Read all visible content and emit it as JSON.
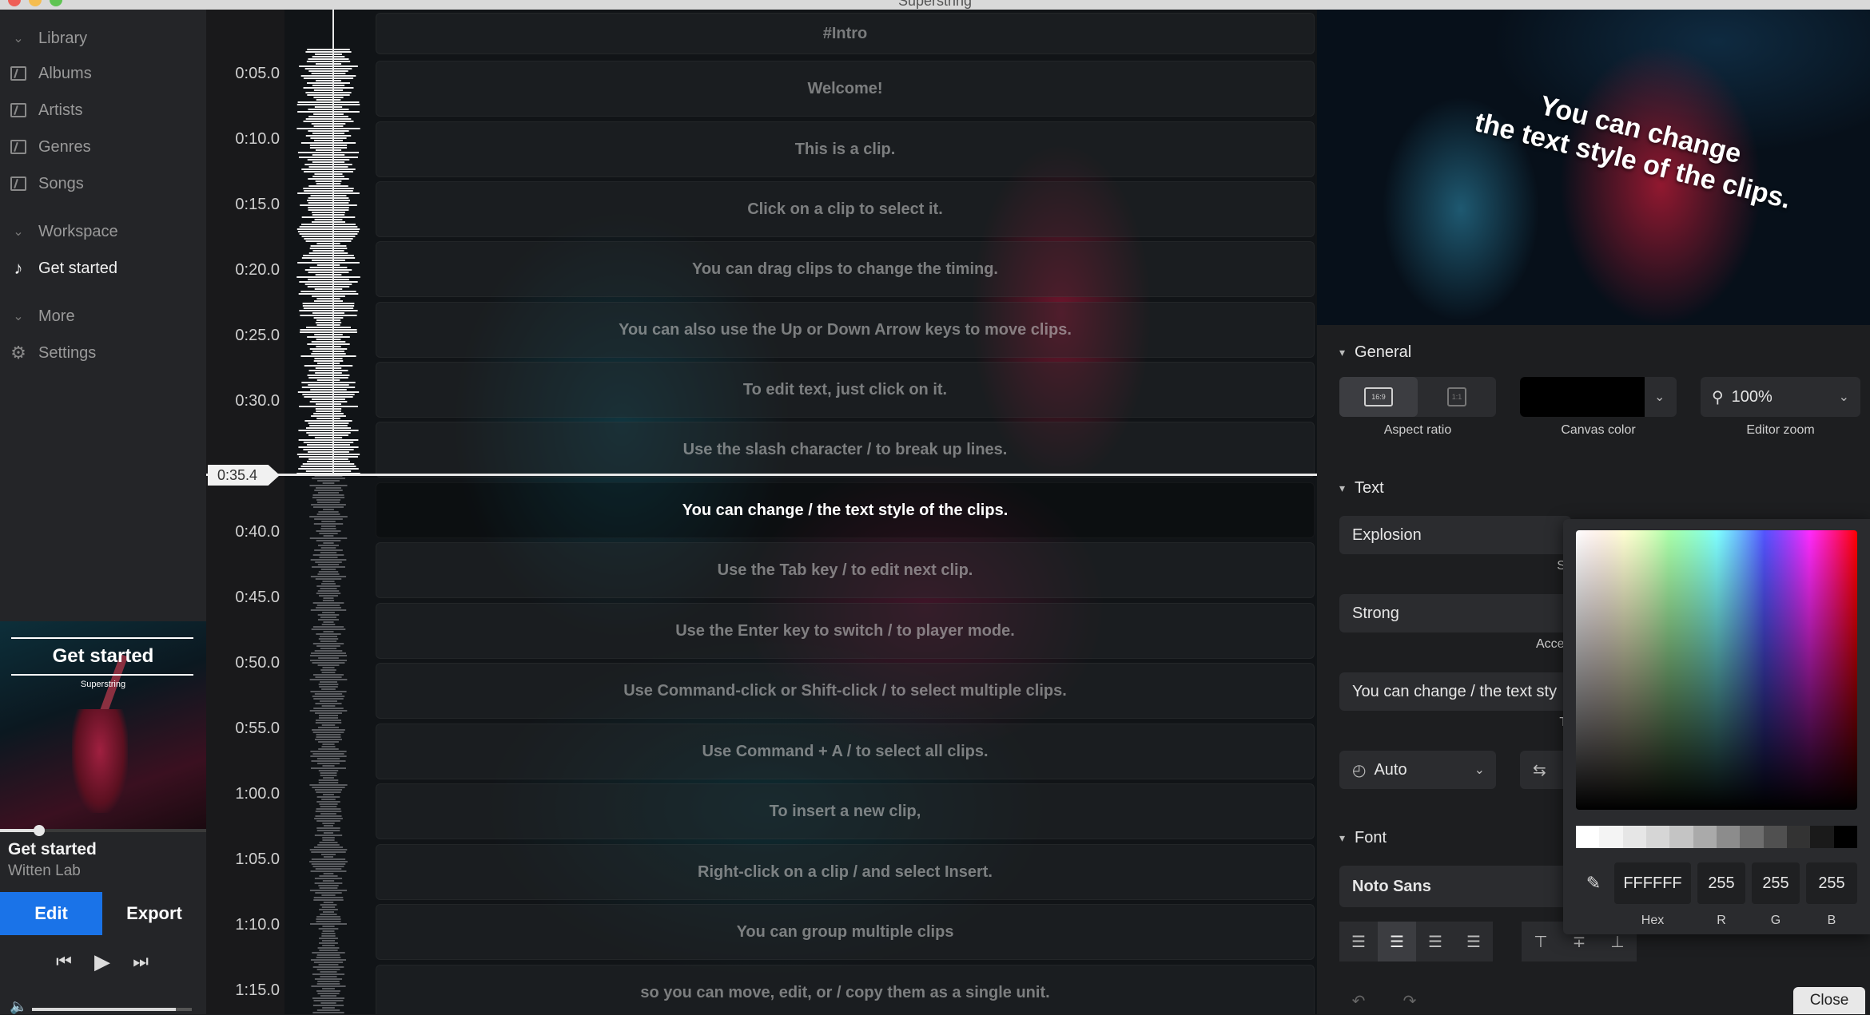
{
  "window": {
    "title": "Superstring"
  },
  "sidebar": {
    "sections": [
      {
        "label": "Library",
        "items": [
          {
            "label": "Albums"
          },
          {
            "label": "Artists"
          },
          {
            "label": "Genres"
          },
          {
            "label": "Songs"
          }
        ]
      },
      {
        "label": "Workspace",
        "items": [
          {
            "label": "Get started"
          }
        ]
      },
      {
        "label": "More",
        "items": [
          {
            "label": "Settings"
          }
        ]
      }
    ],
    "now_playing": {
      "art_title": "Get started",
      "art_subtitle": "Superstring",
      "title": "Get started",
      "artist": "Witten Lab",
      "progress": 0.19,
      "volume": 0.9
    },
    "modes": {
      "edit": "Edit",
      "export": "Export"
    }
  },
  "timeline": {
    "ticks": [
      "0:05.0",
      "0:10.0",
      "0:15.0",
      "0:20.0",
      "0:25.0",
      "0:30.0",
      "0:40.0",
      "0:45.0",
      "0:50.0",
      "0:55.0",
      "1:00.0",
      "1:05.0",
      "1:10.0",
      "1:15.0"
    ],
    "playhead": "0:35.4",
    "clips": [
      "#Intro",
      "Welcome!",
      "This is a clip.",
      "Click on a clip to select it.",
      "You can drag clips to change the timing.",
      "You can also use the Up or Down Arrow keys to move clips.",
      "To edit text, just click on it.",
      "Use the slash character / to break up lines.",
      "You can change / the text style of the clips.",
      "Use the Tab key / to edit next clip.",
      "Use the Enter key to switch / to player mode.",
      "Use Command-click or Shift-click / to select multiple clips.",
      "Use Command + A / to select all clips.",
      "To insert a new clip,",
      "Right-click on a clip / and select Insert.",
      "You can group multiple clips",
      "so you can move, edit, or / copy them as a single unit."
    ]
  },
  "preview": {
    "line1": "You can change",
    "line2": "the text style of the clips."
  },
  "general": {
    "title": "General",
    "aspect_on": "16:9",
    "aspect_off": "1:1",
    "aspect_label": "Aspect ratio",
    "canvas_label": "Canvas color",
    "canvas_color": "#000000",
    "zoom_value": "100%",
    "zoom_label": "Editor zoom"
  },
  "text": {
    "title": "Text",
    "style_value": "Explosion",
    "style_label": "Style",
    "accel_value": "Strong",
    "accel_label": "Acceleration",
    "text_value": "You can change / the text sty",
    "text_label": "Text",
    "auto_value": "Auto"
  },
  "font": {
    "title": "Font",
    "value": "Noto Sans"
  },
  "picker": {
    "hex": "FFFFFF",
    "r": "255",
    "g": "255",
    "b": "255",
    "hex_label": "Hex",
    "r_label": "R",
    "g_label": "G",
    "b_label": "B",
    "swatches": [
      "#ffffff",
      "#f4f4f4",
      "#e6e6e6",
      "#d6d6d6",
      "#c4c4c4",
      "#aaaaaa",
      "#8c8c8c",
      "#6e6e6e",
      "#505050",
      "#333333",
      "#1a1a1a",
      "#000000"
    ]
  },
  "actions": {
    "close": "Close"
  }
}
